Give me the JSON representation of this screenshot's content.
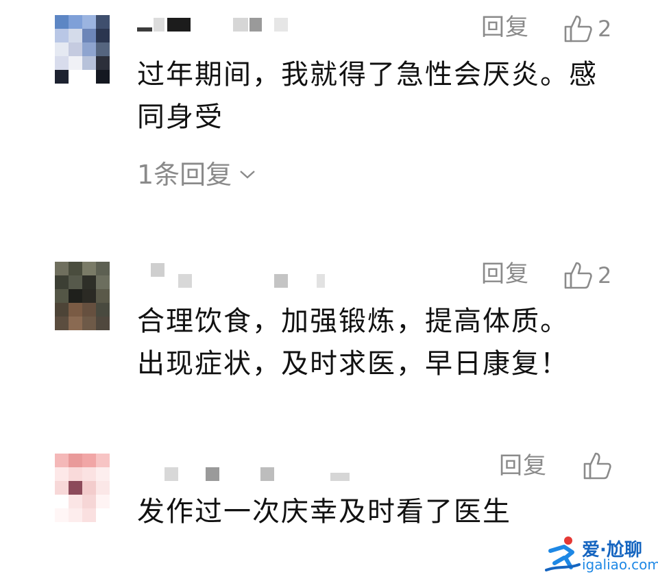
{
  "comments": [
    {
      "text": "过年期间，我就得了急性会厌炎。感\n同身受",
      "reply_label": "回复",
      "like_count": "2",
      "replies_link": "1条回复",
      "avatar_colors": [
        "#5d86c4",
        "#7fa0d8",
        "#9bb4e0",
        "#3f4f6e",
        "#b9c7e6",
        "#d4dbea",
        "#6d86b8",
        "#2b3650",
        "#e5e9f2",
        "#c5cbe0",
        "#8ea4cf",
        "#55657f",
        "#d8dcec",
        "#f0f1f6",
        "#b7c2da",
        "#2c2f3a",
        "#1d2230",
        "#ffffff",
        "#ffffff",
        "#141821"
      ]
    },
    {
      "text": "合理饮食，加强锻炼，提高体质。\n出现症状，及时求医，早日康复！",
      "reply_label": "回复",
      "like_count": "2",
      "avatar_colors": [
        "#6f6f5e",
        "#4a4d3e",
        "#7a7b67",
        "#5d6052",
        "#3c3f34",
        "#56594b",
        "#2e2f28",
        "#6c6e5e",
        "#545646",
        "#1f201c",
        "#2b2a24",
        "#5a5949",
        "#4d4437",
        "#7a5b44",
        "#66503f",
        "#494a3f",
        "#5b4d3f",
        "#8a6a52",
        "#6e5a48",
        "#50483e"
      ]
    },
    {
      "text": "发作过一次庆幸及时看了医生",
      "reply_label": "回复",
      "avatar_colors": [
        "#f4b8b8",
        "#e99a9a",
        "#f1a6a6",
        "#f7c4c4",
        "#fde8e8",
        "#f9dada",
        "#fbe2e2",
        "#fdeeee",
        "#f7d8d8",
        "#8c4a5a",
        "#f3cccc",
        "#fbe7e7",
        "#ffffff",
        "#fbe5e5",
        "#f6d6d6",
        "#fff4f4",
        "#fff6f6",
        "#fdeded",
        "#fae0e0",
        "#ffffff"
      ]
    }
  ],
  "watermark": {
    "title": "爱·尬聊",
    "url": "igaliao.com"
  }
}
